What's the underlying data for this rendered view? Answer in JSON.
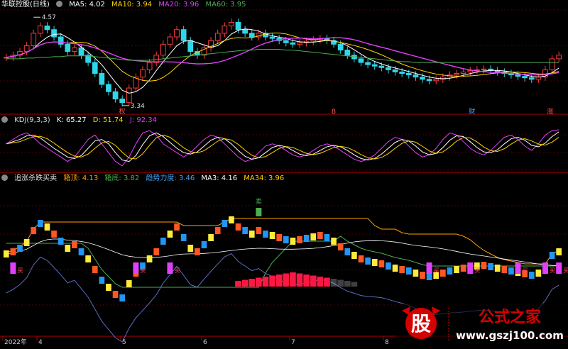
{
  "panel1": {
    "title": "华联控股(日线)",
    "ma5": "MA5: 4.02",
    "ma10": "MA10: 3.94",
    "ma20": "MA20: 3.96",
    "ma60": "MA60: 3.95",
    "high_label": "4.57",
    "low_label": "3.34",
    "event_marks": [
      "权",
      "B",
      "财",
      "涨"
    ]
  },
  "panel2": {
    "title": "KDJ(9,3,3)",
    "k": "K: 65.27",
    "d": "D: 51.74",
    "j": "J: 92.34"
  },
  "panel3": {
    "title": "追涨杀跌买卖",
    "box_top": "箱顶: 4.13",
    "box_bottom": "箱底: 3.82",
    "trend": "趋势力度: 3.46",
    "ma3": "MA3: 4.16",
    "ma34": "MA34: 3.96",
    "sell_label": "卖",
    "buy_marks": [
      "买",
      "买",
      "买",
      "买",
      "买",
      "买",
      "买",
      "买"
    ]
  },
  "x_axis": {
    "labels": [
      "2022年",
      "4",
      "5",
      "6",
      "7",
      "8"
    ]
  },
  "watermark": {
    "big_char": "股",
    "text": "公式之家",
    "url": "www.gszj100.com"
  },
  "chart_data": {
    "type": "candlestick",
    "close": [
      4.02,
      4.05,
      4.1,
      4.18,
      4.35,
      4.45,
      4.4,
      4.3,
      4.2,
      4.1,
      4.15,
      4.05,
      3.95,
      3.8,
      3.65,
      3.55,
      3.45,
      3.4,
      3.6,
      3.75,
      3.85,
      3.95,
      4.05,
      4.2,
      4.3,
      4.4,
      4.25,
      4.1,
      4.05,
      4.15,
      4.25,
      4.35,
      4.45,
      4.5,
      4.4,
      4.35,
      4.3,
      4.35,
      4.3,
      4.28,
      4.25,
      4.22,
      4.2,
      4.22,
      4.24,
      4.26,
      4.28,
      4.25,
      4.2,
      4.12,
      4.05,
      4.0,
      3.95,
      3.92,
      3.9,
      3.88,
      3.85,
      3.82,
      3.8,
      3.78,
      3.75,
      3.72,
      3.7,
      3.72,
      3.75,
      3.78,
      3.8,
      3.82,
      3.84,
      3.85,
      3.86,
      3.84,
      3.82,
      3.8,
      3.78,
      3.76,
      3.74,
      3.72,
      3.75,
      3.85,
      4.0,
      4.05
    ],
    "ma60": [
      4.0,
      4.0,
      4.0,
      4.01,
      4.01,
      4.02,
      4.02,
      4.03,
      4.03,
      4.04,
      4.04,
      4.04,
      4.04,
      4.03,
      4.02,
      4.01,
      4.0,
      3.99,
      3.98,
      3.98,
      3.98,
      3.98,
      3.99,
      4.0,
      4.01,
      4.02,
      4.03,
      4.04,
      4.05,
      4.06,
      4.07,
      4.08,
      4.09,
      4.1,
      4.11,
      4.12,
      4.12,
      4.13,
      4.13,
      4.13,
      4.13,
      4.12,
      4.12,
      4.11,
      4.1,
      4.09,
      4.08,
      4.07,
      4.06,
      4.05,
      4.04,
      4.03,
      4.02,
      4.01,
      4.0,
      3.99,
      3.98,
      3.97,
      3.96,
      3.96,
      3.95,
      3.95,
      3.95,
      3.95,
      3.95,
      3.95,
      3.95,
      3.95,
      3.95,
      3.95,
      3.95,
      3.95,
      3.95,
      3.95,
      3.95,
      3.95,
      3.95,
      3.95,
      3.95,
      3.95,
      3.95,
      3.95
    ],
    "kdj_j": [
      60,
      70,
      80,
      85,
      75,
      60,
      50,
      40,
      30,
      20,
      30,
      50,
      70,
      80,
      60,
      40,
      20,
      10,
      30,
      60,
      85,
      90,
      80,
      60,
      50,
      40,
      30,
      40,
      55,
      70,
      80,
      75,
      60,
      45,
      30,
      20,
      25,
      40,
      55,
      60,
      55,
      45,
      35,
      30,
      35,
      45,
      55,
      60,
      55,
      45,
      35,
      25,
      20,
      25,
      35,
      50,
      65,
      75,
      70,
      55,
      40,
      30,
      35,
      50,
      70,
      85,
      80,
      65,
      50,
      40,
      35,
      45,
      60,
      75,
      80,
      70,
      55,
      45,
      60,
      80,
      90,
      92
    ]
  }
}
